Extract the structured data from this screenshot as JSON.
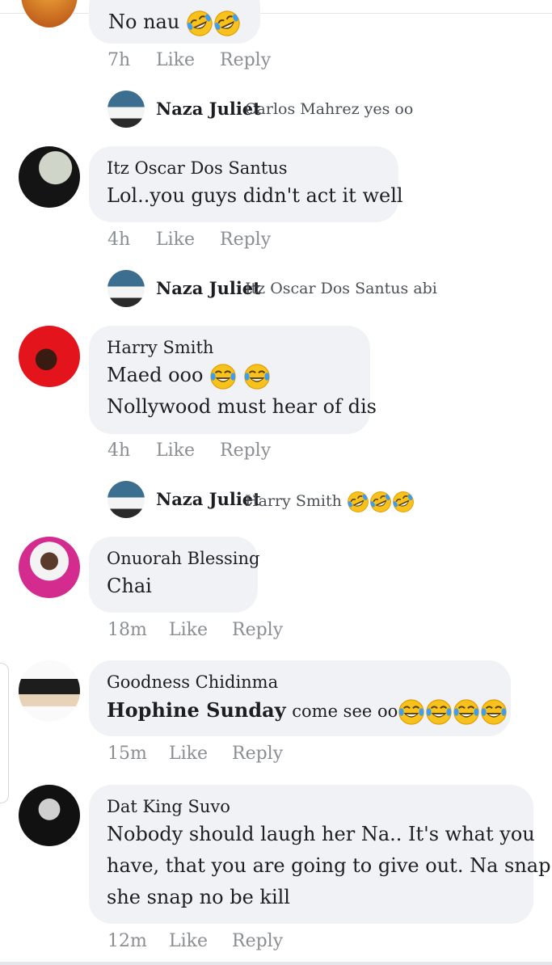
{
  "comments": [
    {
      "text_top": "No nau",
      "time": "7h",
      "like": "Like",
      "reply": "Reply",
      "nested_reply": {
        "author": "Naza Juliet",
        "text": "Carlos Mahrez yes oo"
      }
    },
    {
      "author": "Itz Oscar Dos Santus",
      "text": "Lol..you guys didn't act it well",
      "time": "4h",
      "like": "Like",
      "reply": "Reply",
      "nested_reply": {
        "author": "Naza Juliet",
        "text": "Itz Oscar Dos Santus abi"
      }
    },
    {
      "author": "Harry Smith",
      "line1": "Maed ooo",
      "line2": "Nollywood must hear of dis",
      "time": "4h",
      "like": "Like",
      "reply": "Reply",
      "nested_reply": {
        "author": "Naza Juliet",
        "text": "Harry Smith"
      }
    },
    {
      "author": "Onuorah Blessing",
      "text": "Chai",
      "time": "18m",
      "like": "Like",
      "reply": "Reply"
    },
    {
      "author": "Goodness Chidinma",
      "mention": "Hophine Sunday",
      "text": "come see oo",
      "time": "15m",
      "like": "Like",
      "reply": "Reply"
    },
    {
      "author": "Dat King Suvo",
      "line1": "Nobody should laugh her Na.. It's what you",
      "line2": "have, that you are going to give out. Na snap",
      "line3": "she snap no be kill",
      "time": "12m",
      "like": "Like",
      "reply": "Reply"
    }
  ],
  "icons": {
    "laughing": "rolling-on-floor-laughing-emoji",
    "tears_of_joy": "face-with-tears-of-joy-emoji"
  },
  "colors": {
    "bubble": "#f0f2f5",
    "meta_text": "#8a8d91",
    "emoji_yellow": "#f7b500"
  }
}
